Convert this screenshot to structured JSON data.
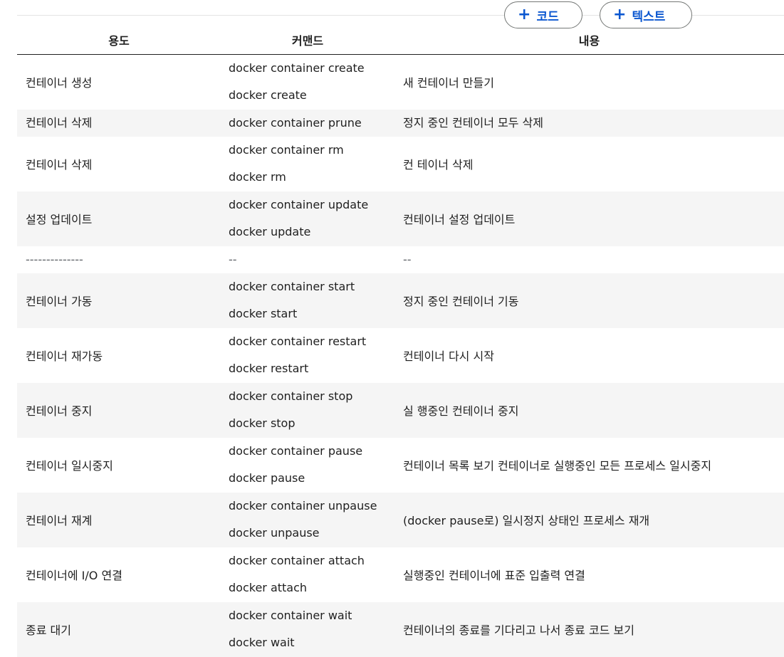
{
  "toolbar": {
    "add_code_label": "코드",
    "add_text_label": "텍스트",
    "plus_glyph": "+"
  },
  "table": {
    "headers": [
      "용도",
      "커맨드",
      "내용"
    ],
    "rows": [
      {
        "purpose": "컨테이너 생성",
        "commands": [
          "docker container create",
          "docker create"
        ],
        "desc": "새 컨테이너 만들기"
      },
      {
        "purpose": "컨테이너 삭제",
        "commands": [
          "docker container prune"
        ],
        "desc": "정지 중인 컨테이너 모두 삭제"
      },
      {
        "purpose": "컨테이너 삭제",
        "commands": [
          "docker container rm",
          "docker rm"
        ],
        "desc": "컨 테이너 삭제"
      },
      {
        "purpose": "설정 업데이트",
        "commands": [
          "docker container update",
          "docker update"
        ],
        "desc": "컨테이너 설정 업데이트"
      },
      {
        "purpose": "--------------",
        "commands": [
          "--"
        ],
        "desc": "--"
      },
      {
        "purpose": "컨테이너 가동",
        "commands": [
          "docker container start",
          "docker start"
        ],
        "desc": "정지 중인 컨테이너 기동"
      },
      {
        "purpose": "컨테이너 재가동",
        "commands": [
          "docker container restart",
          "docker restart"
        ],
        "desc": "컨테이너 다시 시작"
      },
      {
        "purpose": "컨테이너 중지",
        "commands": [
          "docker container stop",
          "docker stop"
        ],
        "desc": "실 행중인 컨테이너 중지"
      },
      {
        "purpose": "컨테이너 일시중지",
        "commands": [
          "docker container pause",
          "docker pause"
        ],
        "desc": "컨테이너 목록 보기 컨테이너로 실행중인 모든 프로세스 일시중지"
      },
      {
        "purpose": "컨테이너 재계",
        "commands": [
          "docker container unpause",
          "docker unpause"
        ],
        "desc": "(docker pause로) 일시정지 상태인 프로세스 재개"
      },
      {
        "purpose": "컨테이너에 I/O 연결",
        "commands": [
          "docker container attach",
          "docker attach"
        ],
        "desc": "실행중인 컨테이너에 표준 입출력 연결"
      },
      {
        "purpose": "종료 대기",
        "commands": [
          "docker container wait",
          "docker wait"
        ],
        "desc": "컨테이너의 종료를 기다리고 나서 종료 코드 보기"
      }
    ]
  },
  "colors": {
    "accent": "#0b57d0",
    "row_stripe": "#f5f5f5",
    "pill_border": "#747775"
  }
}
